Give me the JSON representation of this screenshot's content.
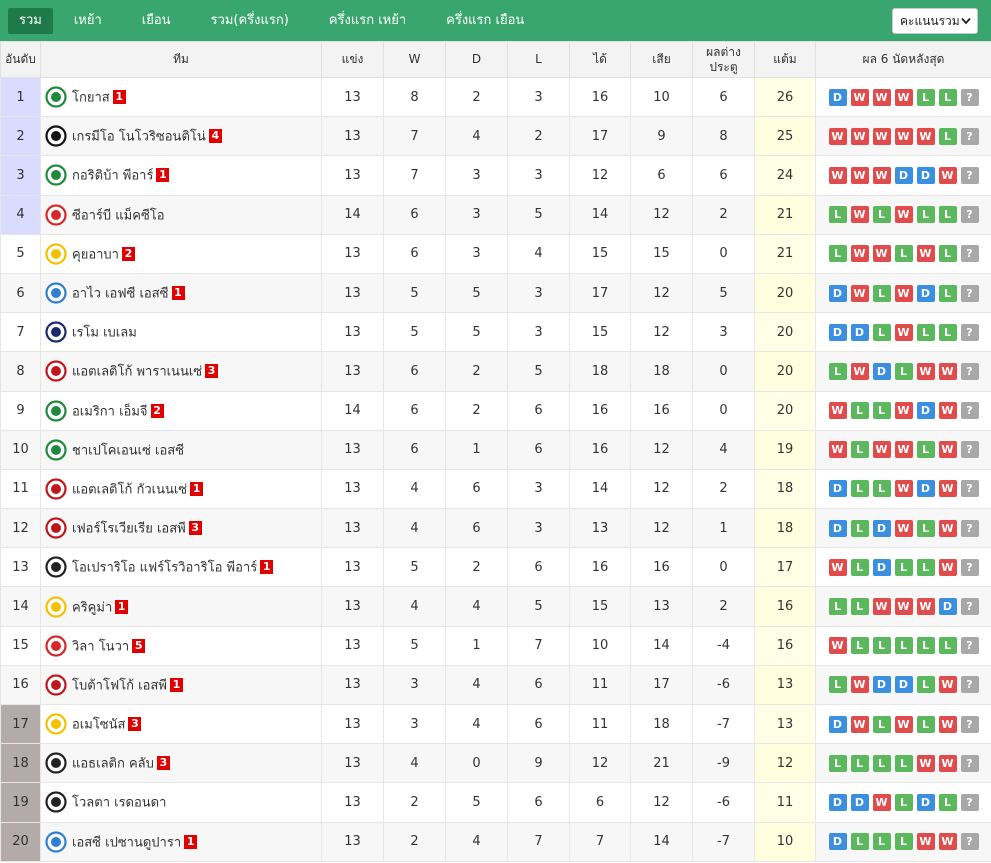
{
  "tabs": [
    "รวม",
    "เหย้า",
    "เยือน",
    "รวม(ครึ่งแรก)",
    "ครึ่งแรก เหย้า",
    "ครึ่งแรก เยือน"
  ],
  "select": {
    "value": "คะแนนรวม"
  },
  "headers": {
    "rank": "อันดับ",
    "team": "ทีม",
    "played": "แข่ง",
    "w": "W",
    "d": "D",
    "l": "L",
    "gf": "ได้",
    "ga": "เสีย",
    "gd_1": "ผลต่าง",
    "gd_2": "ประตู",
    "pts": "แต้ม",
    "form": "ผล 6 นัดหลังสุด"
  },
  "colors": {
    "win": "#e04c4c",
    "draw": "#3b8fe0",
    "loss": "#5cb85c",
    "unknown": "#a8a8a8",
    "header_green": "#3aa66f"
  },
  "rows": [
    {
      "rank": "1",
      "zone": "z1",
      "logo": "goias-logo",
      "team": "โกยาส",
      "badge": "1",
      "p": "13",
      "w": "8",
      "d": "2",
      "l": "3",
      "gf": "16",
      "ga": "10",
      "gd": "6",
      "pts": "26",
      "form": [
        "D",
        "W",
        "W",
        "W",
        "L",
        "L",
        "?"
      ]
    },
    {
      "rank": "2",
      "zone": "z1",
      "logo": "novorizontino-logo",
      "team": "เกรมีโอ โนโวริซอนติโน่",
      "badge": "4",
      "p": "13",
      "w": "7",
      "d": "4",
      "l": "2",
      "gf": "17",
      "ga": "9",
      "gd": "8",
      "pts": "25",
      "form": [
        "W",
        "W",
        "W",
        "W",
        "W",
        "L",
        "?"
      ]
    },
    {
      "rank": "3",
      "zone": "z1",
      "logo": "coritiba-logo",
      "team": "กอริติบ้า พีอาร์",
      "badge": "1",
      "p": "13",
      "w": "7",
      "d": "3",
      "l": "3",
      "gf": "12",
      "ga": "6",
      "gd": "6",
      "pts": "24",
      "form": [
        "W",
        "W",
        "W",
        "D",
        "D",
        "W",
        "?"
      ]
    },
    {
      "rank": "4",
      "zone": "z1",
      "logo": "crb-logo",
      "team": "ซีอาร์บี แม็คซีโอ",
      "badge": "",
      "p": "14",
      "w": "6",
      "d": "3",
      "l": "5",
      "gf": "14",
      "ga": "12",
      "gd": "2",
      "pts": "21",
      "form": [
        "L",
        "W",
        "L",
        "W",
        "L",
        "L",
        "?"
      ]
    },
    {
      "rank": "5",
      "zone": "",
      "logo": "cuiaba-logo",
      "team": "คุยอาบา",
      "badge": "2",
      "p": "13",
      "w": "6",
      "d": "3",
      "l": "4",
      "gf": "15",
      "ga": "15",
      "gd": "0",
      "pts": "21",
      "form": [
        "L",
        "W",
        "W",
        "L",
        "W",
        "L",
        "?"
      ]
    },
    {
      "rank": "6",
      "zone": "",
      "logo": "avai-logo",
      "team": "อาไว เอฟซี เอสซี",
      "badge": "1",
      "p": "13",
      "w": "5",
      "d": "5",
      "l": "3",
      "gf": "17",
      "ga": "12",
      "gd": "5",
      "pts": "20",
      "form": [
        "D",
        "W",
        "L",
        "W",
        "D",
        "L",
        "?"
      ]
    },
    {
      "rank": "7",
      "zone": "",
      "logo": "remo-logo",
      "team": "เรโม เบเลม",
      "badge": "",
      "p": "13",
      "w": "5",
      "d": "5",
      "l": "3",
      "gf": "15",
      "ga": "12",
      "gd": "3",
      "pts": "20",
      "form": [
        "D",
        "D",
        "L",
        "W",
        "L",
        "L",
        "?"
      ]
    },
    {
      "rank": "8",
      "zone": "",
      "logo": "athletico-logo",
      "team": "แอตเลติโก้ พาราเนนเซ่",
      "badge": "3",
      "p": "13",
      "w": "6",
      "d": "2",
      "l": "5",
      "gf": "18",
      "ga": "18",
      "gd": "0",
      "pts": "20",
      "form": [
        "L",
        "W",
        "D",
        "L",
        "W",
        "W",
        "?"
      ]
    },
    {
      "rank": "9",
      "zone": "",
      "logo": "america-logo",
      "team": "อเมริกา เอ็มจี",
      "badge": "2",
      "p": "14",
      "w": "6",
      "d": "2",
      "l": "6",
      "gf": "16",
      "ga": "16",
      "gd": "0",
      "pts": "20",
      "form": [
        "W",
        "L",
        "L",
        "W",
        "D",
        "W",
        "?"
      ]
    },
    {
      "rank": "10",
      "zone": "",
      "logo": "chapecoense-logo",
      "team": "ชาเปโคเอนเซ่ เอสซี",
      "badge": "",
      "p": "13",
      "w": "6",
      "d": "1",
      "l": "6",
      "gf": "16",
      "ga": "12",
      "gd": "4",
      "pts": "19",
      "form": [
        "W",
        "L",
        "W",
        "W",
        "L",
        "W",
        "?"
      ]
    },
    {
      "rank": "11",
      "zone": "",
      "logo": "atletico-go-logo",
      "team": "แอตเลติโก้ กัวเนนเซ่",
      "badge": "1",
      "p": "13",
      "w": "4",
      "d": "6",
      "l": "3",
      "gf": "14",
      "ga": "12",
      "gd": "2",
      "pts": "18",
      "form": [
        "D",
        "L",
        "L",
        "W",
        "D",
        "W",
        "?"
      ]
    },
    {
      "rank": "12",
      "zone": "",
      "logo": "ferroviaria-logo",
      "team": "เฟอร์โรเวียเรีย เอสพี",
      "badge": "3",
      "p": "13",
      "w": "4",
      "d": "6",
      "l": "3",
      "gf": "13",
      "ga": "12",
      "gd": "1",
      "pts": "18",
      "form": [
        "D",
        "L",
        "D",
        "W",
        "L",
        "W",
        "?"
      ]
    },
    {
      "rank": "13",
      "zone": "",
      "logo": "operario-logo",
      "team": "โอเปราริโอ แฟร์โรวิอาริโอ พีอาร์",
      "badge": "1",
      "p": "13",
      "w": "5",
      "d": "2",
      "l": "6",
      "gf": "16",
      "ga": "16",
      "gd": "0",
      "pts": "17",
      "form": [
        "W",
        "L",
        "D",
        "L",
        "L",
        "W",
        "?"
      ]
    },
    {
      "rank": "14",
      "zone": "",
      "logo": "criciuma-logo",
      "team": "คริคูม่า",
      "badge": "1",
      "p": "13",
      "w": "4",
      "d": "4",
      "l": "5",
      "gf": "15",
      "ga": "13",
      "gd": "2",
      "pts": "16",
      "form": [
        "L",
        "L",
        "W",
        "W",
        "W",
        "D",
        "?"
      ]
    },
    {
      "rank": "15",
      "zone": "",
      "logo": "vila-nova-logo",
      "team": "วิลา โนวา",
      "badge": "5",
      "p": "13",
      "w": "5",
      "d": "1",
      "l": "7",
      "gf": "10",
      "ga": "14",
      "gd": "-4",
      "pts": "16",
      "form": [
        "W",
        "L",
        "L",
        "L",
        "L",
        "L",
        "?"
      ]
    },
    {
      "rank": "16",
      "zone": "",
      "logo": "botafogo-sp-logo",
      "team": "โบต้าโฟโก้ เอสพี",
      "badge": "1",
      "p": "13",
      "w": "3",
      "d": "4",
      "l": "6",
      "gf": "11",
      "ga": "17",
      "gd": "-6",
      "pts": "13",
      "form": [
        "L",
        "W",
        "D",
        "D",
        "L",
        "W",
        "?"
      ]
    },
    {
      "rank": "17",
      "zone": "z3",
      "logo": "amazonas-logo",
      "team": "อเมโซนัส",
      "badge": "3",
      "p": "13",
      "w": "3",
      "d": "4",
      "l": "6",
      "gf": "11",
      "ga": "18",
      "gd": "-7",
      "pts": "13",
      "form": [
        "D",
        "W",
        "L",
        "W",
        "L",
        "W",
        "?"
      ]
    },
    {
      "rank": "18",
      "zone": "z3",
      "logo": "athletic-club-logo",
      "team": "แอธเลติก คลับ",
      "badge": "3",
      "p": "13",
      "w": "4",
      "d": "0",
      "l": "9",
      "gf": "12",
      "ga": "21",
      "gd": "-9",
      "pts": "12",
      "form": [
        "L",
        "L",
        "L",
        "L",
        "W",
        "W",
        "?"
      ]
    },
    {
      "rank": "19",
      "zone": "z3",
      "logo": "volta-redonda-logo",
      "team": "โวลตา เรดอนดา",
      "badge": "",
      "p": "13",
      "w": "2",
      "d": "5",
      "l": "6",
      "gf": "6",
      "ga": "12",
      "gd": "-6",
      "pts": "11",
      "form": [
        "D",
        "D",
        "W",
        "L",
        "D",
        "L",
        "?"
      ]
    },
    {
      "rank": "20",
      "zone": "z3",
      "logo": "paysandu-logo",
      "team": "เอสซี เปซานดูปารา",
      "badge": "1",
      "p": "13",
      "w": "2",
      "d": "4",
      "l": "7",
      "gf": "7",
      "ga": "14",
      "gd": "-7",
      "pts": "10",
      "form": [
        "D",
        "L",
        "L",
        "L",
        "W",
        "W",
        "?"
      ]
    }
  ]
}
